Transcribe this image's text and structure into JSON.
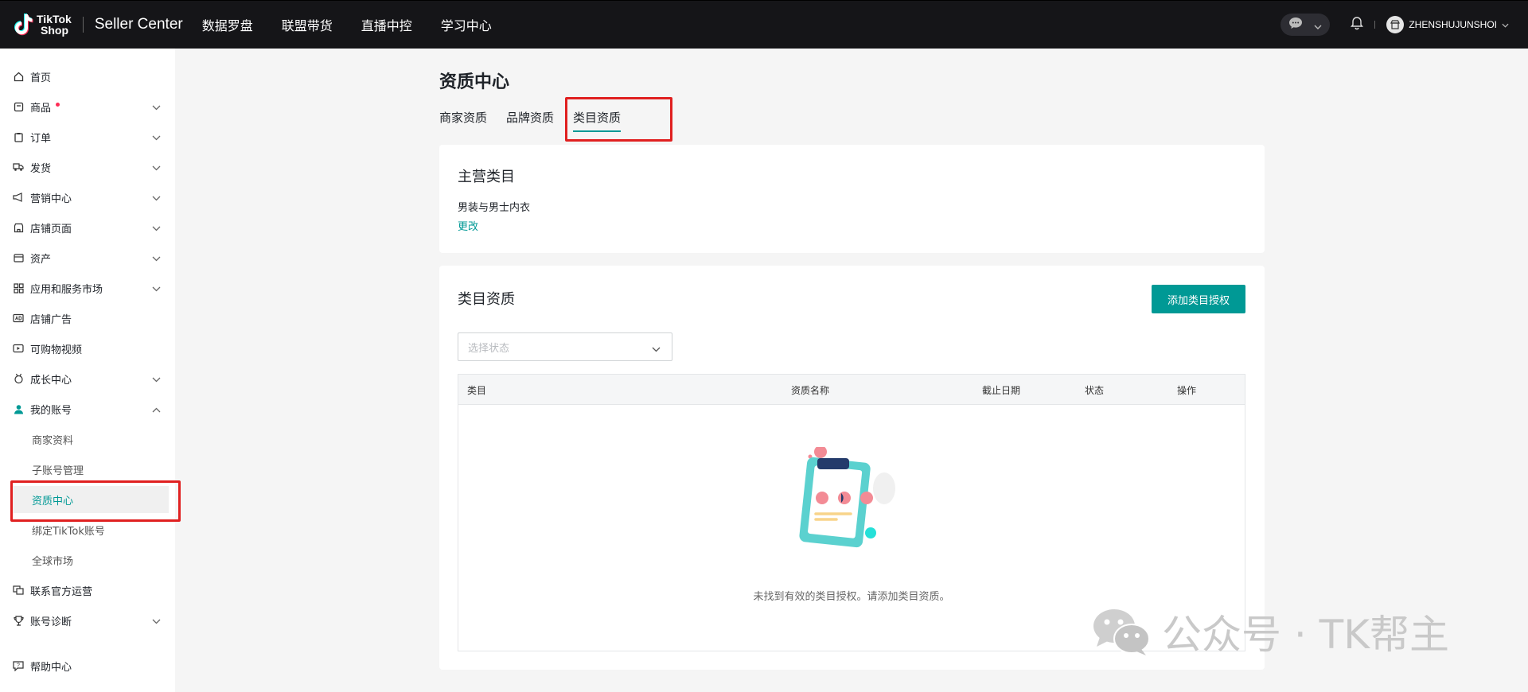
{
  "topbar": {
    "logo_line1": "TikTok",
    "logo_line2": "Shop",
    "brand_title": "Seller Center",
    "nav": [
      "数据罗盘",
      "联盟带货",
      "直播中控",
      "学习中心"
    ],
    "user_name": "ZHENSHUJUNSHOI",
    "icons": [
      "chat-icon",
      "bell-icon",
      "store-avatar-icon"
    ]
  },
  "sidebar": {
    "items": [
      {
        "label": "首页",
        "icon": "home-icon"
      },
      {
        "label": "商品",
        "icon": "product-icon",
        "badge": true,
        "expandable": true
      },
      {
        "label": "订单",
        "icon": "order-icon",
        "expandable": true
      },
      {
        "label": "发货",
        "icon": "truck-icon",
        "expandable": true
      },
      {
        "label": "营销中心",
        "icon": "megaphone-icon",
        "expandable": true
      },
      {
        "label": "店铺页面",
        "icon": "store-icon",
        "expandable": true
      },
      {
        "label": "资产",
        "icon": "wallet-icon",
        "expandable": true
      },
      {
        "label": "应用和服务市场",
        "icon": "apps-icon",
        "expandable": true
      },
      {
        "label": "店铺广告",
        "icon": "ad-icon"
      },
      {
        "label": "可购物视频",
        "icon": "video-icon"
      },
      {
        "label": "成长中心",
        "icon": "medal-icon",
        "expandable": true
      },
      {
        "label": "我的账号",
        "icon": "user-icon",
        "expanded": true
      }
    ],
    "account_sub": [
      "商家资料",
      "子账号管理",
      "资质中心",
      "绑定TikTok账号",
      "全球市场"
    ],
    "bottom_items": [
      {
        "label": "联系官方运营",
        "icon": "contact-icon"
      },
      {
        "label": "账号诊断",
        "icon": "trophy-icon",
        "expandable": true
      },
      {
        "label": "帮助中心",
        "icon": "help-icon"
      }
    ]
  },
  "main": {
    "page_title": "资质中心",
    "tabs": [
      "商家资质",
      "品牌资质",
      "类目资质"
    ],
    "active_tab": "类目资质",
    "main_category": {
      "title": "主营类目",
      "value": "男装与男士内衣",
      "change_link": "更改"
    },
    "category_qualification": {
      "title": "类目资质",
      "add_button": "添加类目授权",
      "status_placeholder": "选择状态",
      "columns": [
        "类目",
        "资质名称",
        "截止日期",
        "状态",
        "操作"
      ],
      "empty_text": "未找到有效的类目授权。请添加类目资质。"
    }
  },
  "watermark": {
    "text": "公众号 · TK帮主"
  },
  "colors": {
    "accent": "#009995",
    "topbar": "#151518",
    "highlight_box": "#e02020",
    "badge_red": "#fe2c55"
  }
}
